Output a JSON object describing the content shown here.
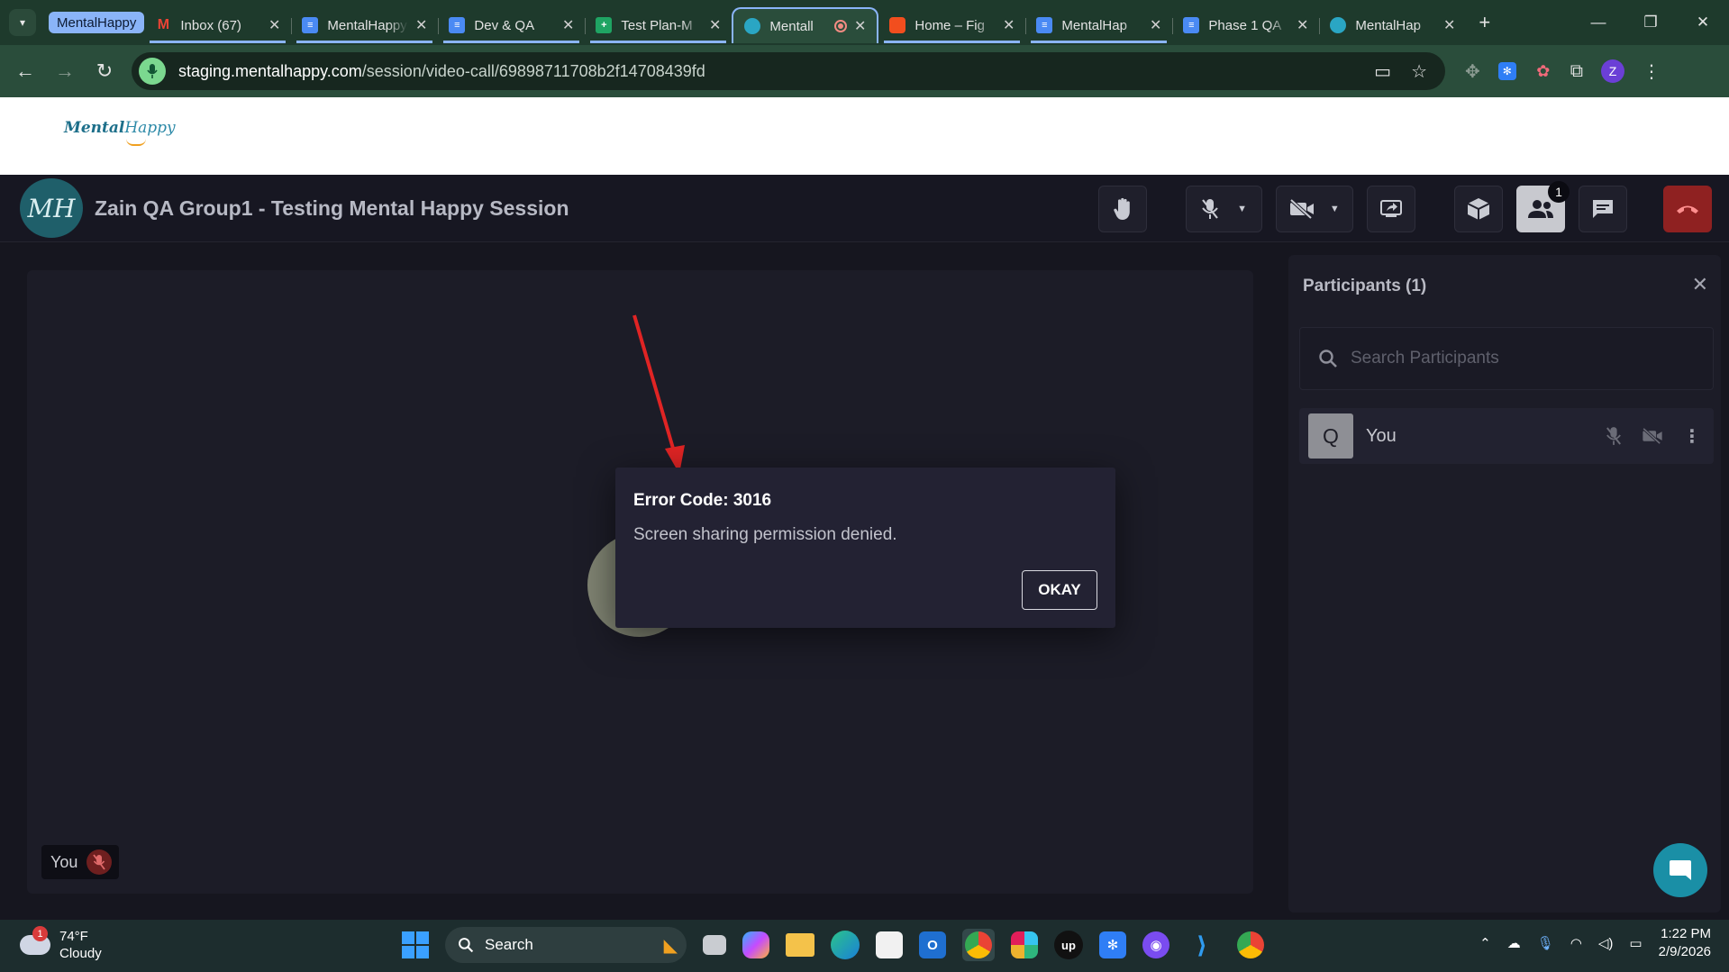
{
  "browser": {
    "group_label": "MentalHappy",
    "tabs": [
      {
        "title": "Inbox (67)",
        "icon": "gmail-icon",
        "color": "#ea4335"
      },
      {
        "title": "MentalHappy",
        "icon": "docs-icon",
        "color": "#4a8af4"
      },
      {
        "title": "Dev & QA",
        "icon": "docs-icon",
        "color": "#4a8af4"
      },
      {
        "title": "Test Plan-M",
        "icon": "sheets-icon",
        "color": "#1fa463"
      },
      {
        "title": "Mentall",
        "icon": "mentalhappy-icon",
        "color": "#2aa6c4"
      },
      {
        "title": "Home – Fig",
        "icon": "figma-icon",
        "color": "#f24e1e"
      },
      {
        "title": "MentalHap",
        "icon": "docs-icon",
        "color": "#4a8af4"
      },
      {
        "title": "Phase 1 QA",
        "icon": "docs-icon",
        "color": "#4a8af4"
      },
      {
        "title": "MentalHap",
        "icon": "mentalhappy-icon",
        "color": "#2aa6c4"
      }
    ],
    "url_host": "staging.mentalhappy.com",
    "url_path": "/session/video-call/69898711708b2f14708439fd",
    "profile_initial": "Z"
  },
  "site": {
    "logo_main": "Mental",
    "logo_sub": "Happy"
  },
  "call": {
    "avatar_text": "MH",
    "title": "Zain QA Group1 - Testing Mental Happy Session",
    "participants_badge": "1"
  },
  "stage": {
    "you_label": "You"
  },
  "dialog": {
    "title": "Error Code: 3016",
    "message": "Screen sharing permission denied.",
    "button": "OKAY"
  },
  "participants": {
    "title": "Participants (1)",
    "search_placeholder": "Search Participants",
    "list": [
      {
        "initial": "Q",
        "name": "You"
      }
    ]
  },
  "taskbar": {
    "weather_badge": "1",
    "temperature": "74°F",
    "condition": "Cloudy",
    "search_label": "Search",
    "time": "1:22 PM",
    "date": "2/9/2026"
  },
  "colors": {
    "accent_blue": "#8ab4f8",
    "hangup_red": "#8f2121",
    "fab_teal": "#1a8fa6",
    "annotation_arrow": "#e02424"
  }
}
